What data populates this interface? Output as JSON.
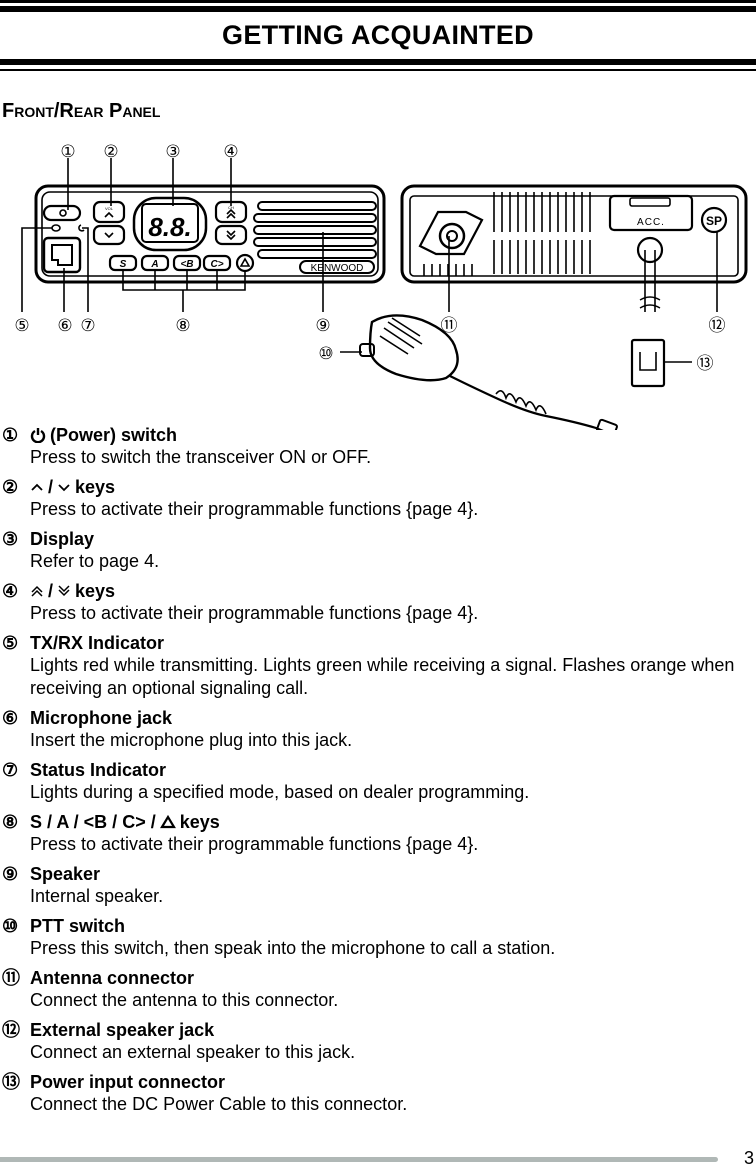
{
  "header": {
    "title": "GETTING ACQUAINTED"
  },
  "section": {
    "title": "Front/Rear Panel"
  },
  "diagram": {
    "callouts": [
      "①",
      "②",
      "③",
      "④",
      "⑤",
      "⑥",
      "⑦",
      "⑧",
      "⑨",
      "⑩",
      "⑪",
      "⑫",
      "⑬"
    ],
    "front_panel": {
      "display_text": "8.8.",
      "key_labels": {
        "vol": "VOL",
        "ch": "CH",
        "s": "S",
        "a": "A",
        "b": "<B",
        "c": "C>"
      },
      "brand": "KENWOOD"
    },
    "rear_panel": {
      "acc_label": "ACC.",
      "sp_label": "SP"
    }
  },
  "items": [
    {
      "num": "①",
      "icon": "power-icon",
      "title": "(Power) switch",
      "desc": "Press to switch the transceiver ON or OFF."
    },
    {
      "num": "②",
      "icon": "up-down-icon",
      "title": "keys",
      "sep": "/",
      "desc": "Press to activate their programmable functions {page 4}."
    },
    {
      "num": "③",
      "title": "Display",
      "desc": "Refer to page 4."
    },
    {
      "num": "④",
      "icon": "double-up-down-icon",
      "title": "keys",
      "sep": "/",
      "desc": "Press to activate their programmable functions {page 4}."
    },
    {
      "num": "⑤",
      "title": "TX/RX Indicator",
      "desc": "Lights red while transmitting.  Lights green while receiving a signal.  Flashes orange when receiving an optional signaling call."
    },
    {
      "num": "⑥",
      "title": "Microphone jack",
      "desc": "Insert the microphone plug into this jack."
    },
    {
      "num": "⑦",
      "title": "Status Indicator",
      "desc": "Lights during a specified mode, based on dealer programming."
    },
    {
      "num": "⑧",
      "title": "S / A / <B / C> /",
      "title_suffix": "keys",
      "icon": "triangle-icon",
      "desc": "Press to activate their programmable functions {page 4}."
    },
    {
      "num": "⑨",
      "title": "Speaker",
      "desc": "Internal speaker."
    },
    {
      "num": "⑩",
      "title": "PTT switch",
      "desc": "Press this switch, then speak into the microphone to call a station."
    },
    {
      "num": "⑪",
      "title": "Antenna connector",
      "desc": "Connect the antenna to this connector."
    },
    {
      "num": "⑫",
      "title": "External speaker jack",
      "desc": "Connect an external speaker to this jack."
    },
    {
      "num": "⑬",
      "title": "Power input connector",
      "desc": "Connect the DC Power Cable to this connector."
    }
  ],
  "footer": {
    "page_number": "3"
  }
}
